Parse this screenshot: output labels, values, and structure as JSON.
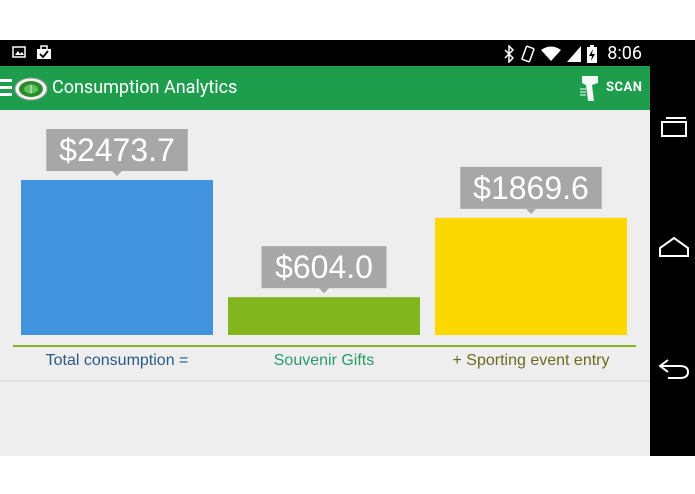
{
  "status_bar": {
    "time": "8:06",
    "left_icons": [
      "image-icon",
      "briefcase-check-icon"
    ],
    "right_icons": [
      "bluetooth-icon",
      "vibrate-icon",
      "wifi-icon",
      "signal-icon",
      "battery-charging-icon"
    ]
  },
  "app_bar": {
    "title": "Consumption Analytics",
    "scan_label": "SCAN",
    "color": "#1e9e4d"
  },
  "chart_data": {
    "type": "bar",
    "categories": [
      "Total consumption =",
      "Souvenir Gifts",
      "+ Sporting event entry"
    ],
    "values": [
      2473.7,
      604.0,
      1869.6
    ],
    "value_labels": [
      "$2473.7",
      "$604.0",
      "$1869.6"
    ],
    "bar_colors": [
      "#4193dd",
      "#83b51f",
      "#fdd700"
    ],
    "label_colors": [
      "#2a5a85",
      "#2a9a6a",
      "#6b6a1f"
    ],
    "baseline_color": "#83b51f",
    "ylim": [
      0,
      2473.7
    ],
    "title": "",
    "xlabel": "",
    "ylabel": ""
  },
  "nav_bar": {
    "buttons": [
      "recent-apps-icon",
      "home-icon",
      "back-icon"
    ]
  }
}
